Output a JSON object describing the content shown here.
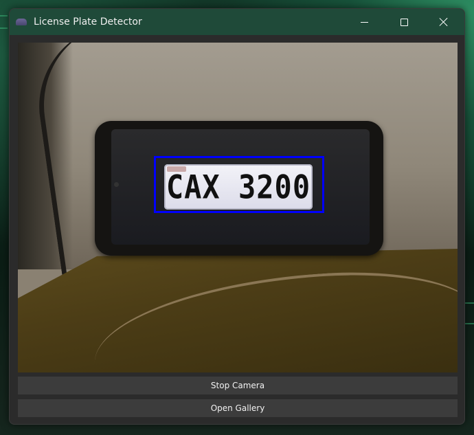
{
  "window": {
    "title": "License Plate Detector",
    "icon": "app-icon",
    "controls": {
      "minimize": "minimize-icon",
      "maximize": "maximize-icon",
      "close": "close-icon"
    }
  },
  "camera_feed": {
    "detected_plate_text": "CAX 3200",
    "bounding_box_color": "#0000ff"
  },
  "actions": {
    "stop_camera_label": "Stop Camera",
    "open_gallery_label": "Open Gallery"
  },
  "colors": {
    "titlebar": "#1f4a39",
    "window_bg": "#2b2b2b",
    "button_bg": "#3c3c3c"
  }
}
